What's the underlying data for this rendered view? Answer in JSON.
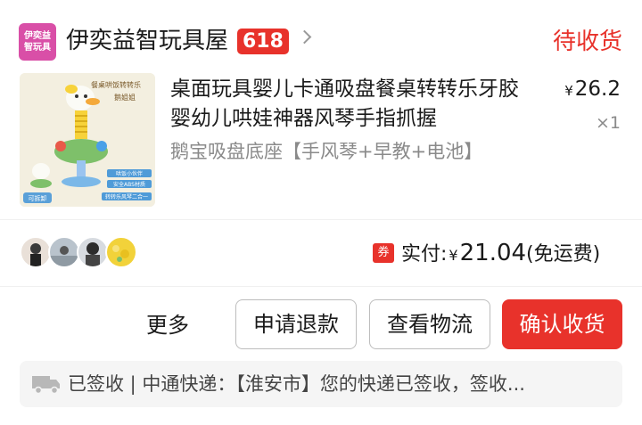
{
  "shop": {
    "logo_text": "伊奕益智玩具",
    "name": "伊奕益智玩具屋",
    "badge": "618",
    "status": "待收货"
  },
  "product": {
    "title": "桌面玩具婴儿卡通吸盘餐桌转转乐牙胶婴幼儿哄娃神器风琴手指抓握",
    "variant": "鹅宝吸盘底座【手风琴+早教+电池】",
    "currency": "¥",
    "price": "26.2",
    "quantity": "×1",
    "image_labels": {
      "top": "餐桌哄饭转转乐",
      "top2": "鹅姐姐",
      "tag1": "哄饭小伙伴",
      "tag2": "安全ABS材质",
      "tag3": "转转乐风琴二合一",
      "corner": "可拆卸"
    }
  },
  "payment": {
    "coupon_icon": "券",
    "label": "实付:",
    "currency": "¥",
    "amount": "21.04",
    "note": "(免运费)"
  },
  "actions": {
    "more": "更多",
    "refund": "申请退款",
    "logistics": "查看物流",
    "confirm": "确认收货"
  },
  "logistics": {
    "icon": "truck-icon",
    "text": "已签收 | 中通快递：【淮安市】您的快递已签收，签收..."
  },
  "colors": {
    "accent": "#e8322b",
    "logo_bg": "#d94fa7",
    "muted": "#8a8a8a"
  }
}
